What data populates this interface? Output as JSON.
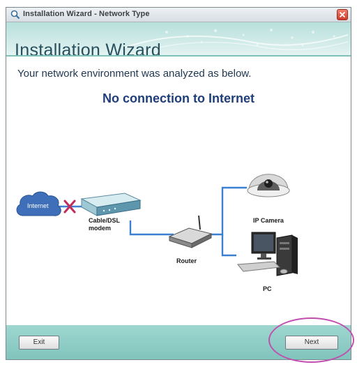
{
  "window": {
    "title": "Installation Wizard - Network Type"
  },
  "header": {
    "title": "Installation Wizard"
  },
  "main": {
    "analysis_text": "Your network environment was analyzed as below.",
    "status": "No connection to Internet"
  },
  "diagram": {
    "internet_label": "Internet",
    "modem_label_line1": "Cable/DSL",
    "modem_label_line2": "modem",
    "router_label": "Router",
    "ip_camera_label": "IP Camera",
    "pc_label": "PC"
  },
  "footer": {
    "exit_label": "Exit",
    "next_label": "Next"
  },
  "colors": {
    "accent": "#7fc4bc",
    "connection_line": "#3b7fd0",
    "error_mark": "#c22a5a",
    "highlight": "#c04fb0"
  }
}
